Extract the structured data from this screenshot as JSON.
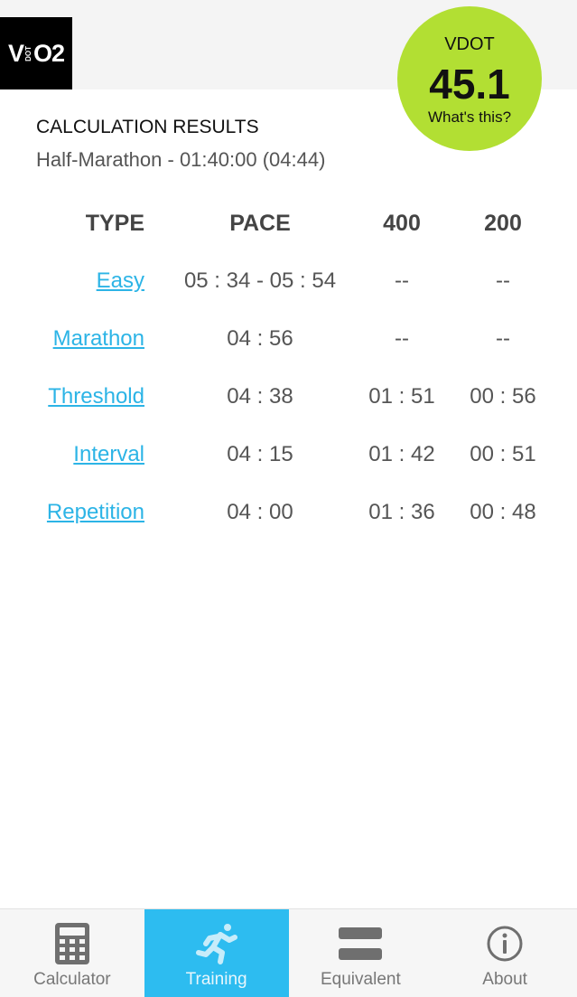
{
  "logo": {
    "left": "V",
    "middle": "DOT",
    "right": "O2"
  },
  "vdot": {
    "label": "VDOT",
    "value": "45.1",
    "help": "What's this?"
  },
  "results": {
    "title": "CALCULATION RESULTS",
    "subtitle": "Half-Marathon - 01:40:00 (04:44)"
  },
  "table": {
    "headers": {
      "type": "TYPE",
      "pace": "PACE",
      "d400": "400",
      "d200": "200"
    },
    "rows": [
      {
        "type": "Easy",
        "pace": "05 : 34 - 05 : 54",
        "d400": "--",
        "d200": "--"
      },
      {
        "type": "Marathon",
        "pace": "04 : 56",
        "d400": "--",
        "d200": "--"
      },
      {
        "type": "Threshold",
        "pace": "04 : 38",
        "d400": "01 : 51",
        "d200": "00 : 56"
      },
      {
        "type": "Interval",
        "pace": "04 : 15",
        "d400": "01 : 42",
        "d200": "00 : 51"
      },
      {
        "type": "Repetition",
        "pace": "04 : 00",
        "d400": "01 : 36",
        "d200": "00 : 48"
      }
    ]
  },
  "tabs": [
    {
      "label": "Calculator",
      "icon": "calculator-icon"
    },
    {
      "label": "Training",
      "icon": "runner-icon",
      "active": true
    },
    {
      "label": "Equivalent",
      "icon": "equivalent-icon"
    },
    {
      "label": "About",
      "icon": "info-icon"
    }
  ],
  "colors": {
    "accent": "#2dbcf0",
    "link": "#2cb4e6",
    "badge": "#b2df33"
  }
}
